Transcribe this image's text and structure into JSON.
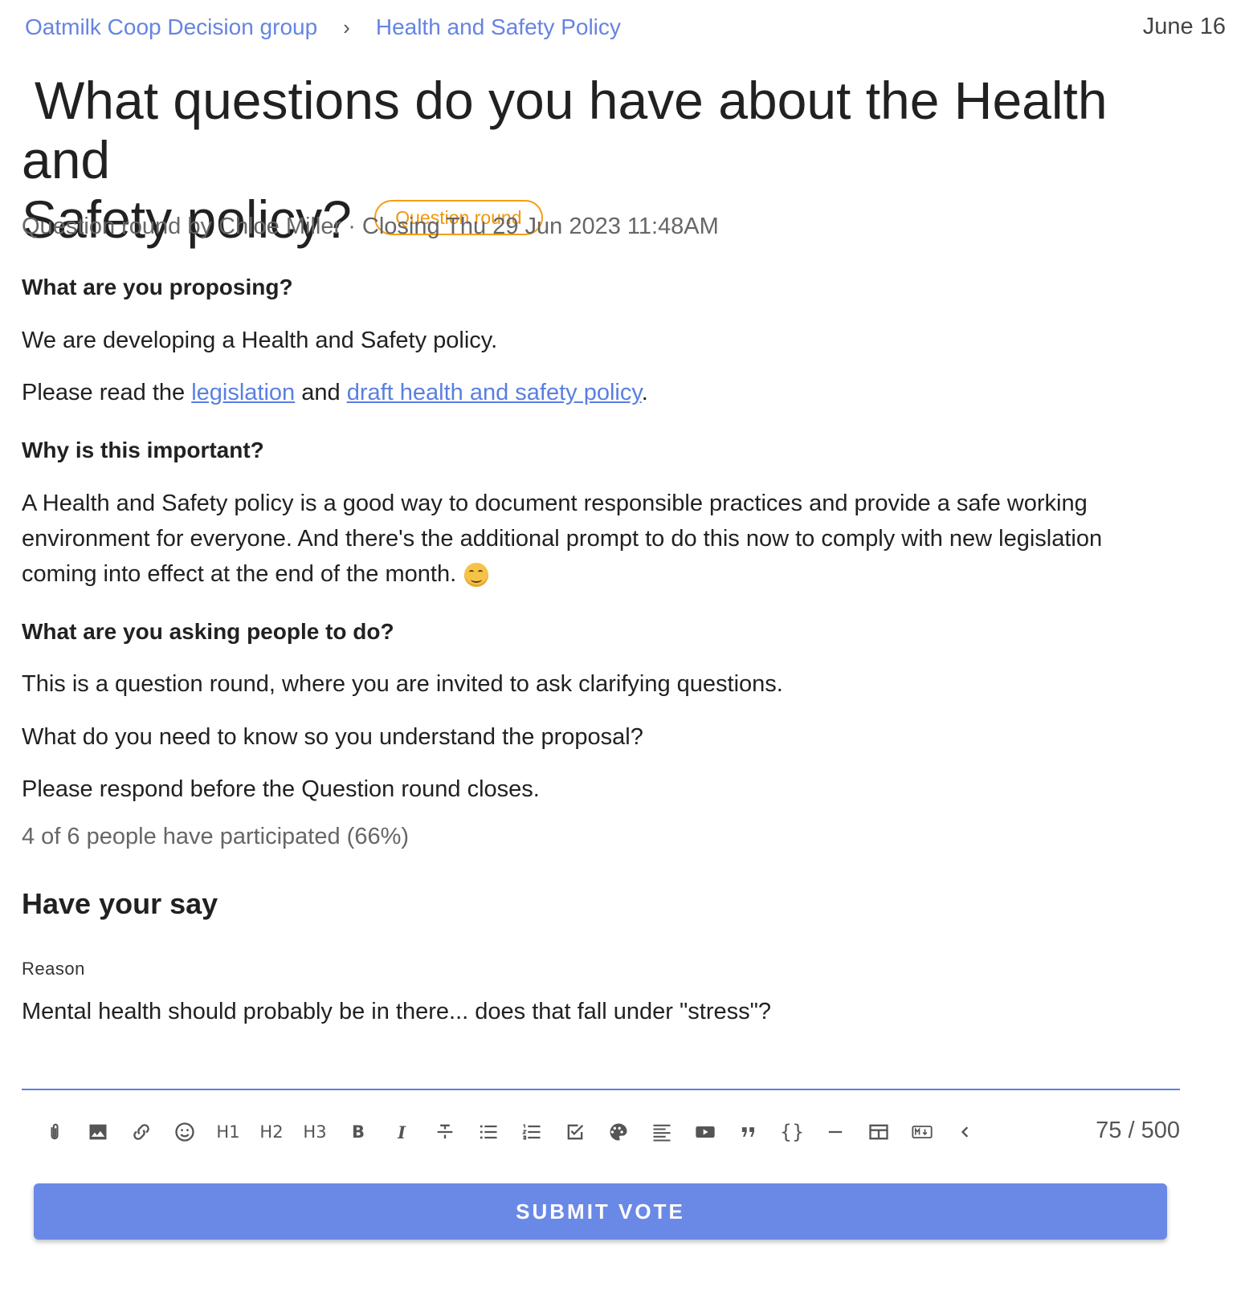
{
  "breadcrumb": {
    "group": "Oatmilk Coop Decision group",
    "separator": "›",
    "thread": "Health and Safety Policy"
  },
  "date": "June 16",
  "poll": {
    "title_line1": "What questions do you have about the Health and",
    "title_line2": "Safety policy?",
    "badge": "Question round",
    "meta": "Question round by Chloe Miller · Closing Thu 29 Jun 2023 11:48AM"
  },
  "details": {
    "heading_proposing": "What are you proposing?",
    "p1": "We are developing a Health and Safety policy.",
    "p2_prefix": "Please read the ",
    "p2_link1": "legislation",
    "p2_mid": " and ",
    "p2_link2": "draft health and safety policy",
    "p2_suffix": ".",
    "heading_why": "Why is this important?",
    "p3": "A Health and Safety policy is a good way to document responsible practices and provide a safe working environment for everyone. And there's the additional prompt to do this now to comply with new legislation coming into effect at the end of the month.",
    "heading_ask": "What are you asking people to do?",
    "p4": "This is a question round, where you are invited to ask clarifying questions.",
    "p5": "What do you need to know so you understand the proposal?",
    "p6": "Please respond before the Question round closes.",
    "participation": "4 of 6 people have participated (66%)",
    "participation_fraction": 0.66
  },
  "vote_form": {
    "heading": "Have your say",
    "reason_label": "Reason",
    "reason_value": "Mental health should probably be in there... does that fall under \"stress\"?",
    "counter": "75 / 500",
    "toolbar": {
      "attach": "attach-icon",
      "image": "image-icon",
      "link": "link-icon",
      "emoji": "emoji-icon",
      "h1": "H1",
      "h2": "H2",
      "h3": "H3",
      "bold": "B",
      "italic": "I",
      "strike": "strikethrough-icon",
      "bullet_list": "bullet-list-icon",
      "ordered_list": "ordered-list-icon",
      "task_list": "checkbox-icon",
      "color": "palette-icon",
      "align": "align-icon",
      "video": "youtube-icon",
      "quote": "quote-icon",
      "code": "{}",
      "rule": "horizontal-rule-icon",
      "table": "table-icon",
      "markdown": "markdown-icon",
      "collapse": "chevron-left-icon"
    },
    "submit_label": "SUBMIT VOTE"
  }
}
